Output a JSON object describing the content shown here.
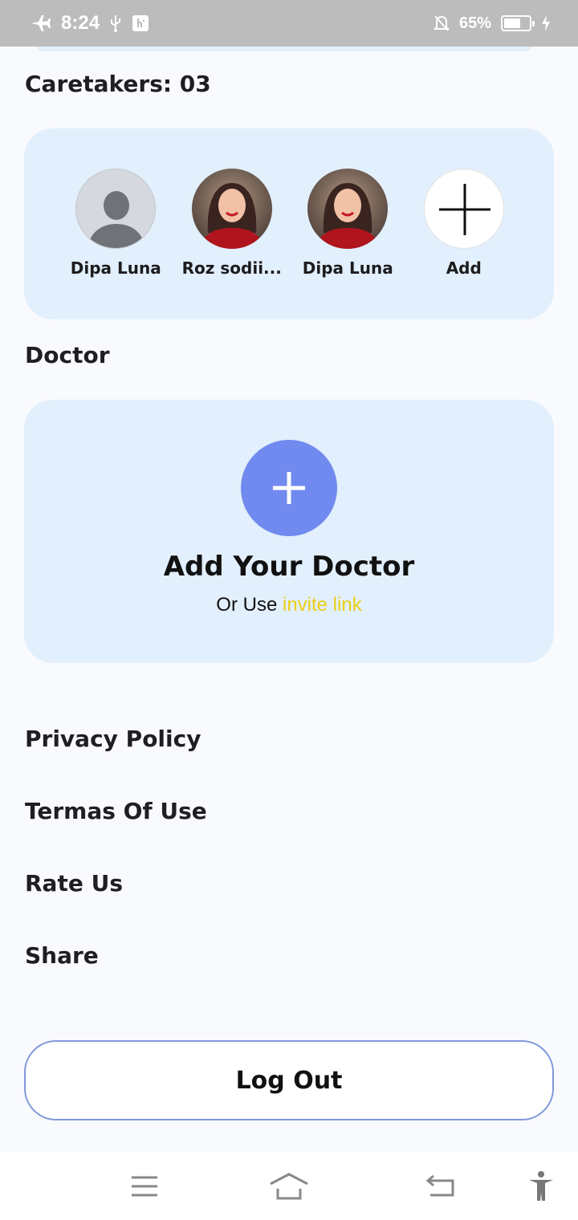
{
  "status_bar": {
    "time": "8:24",
    "battery_pct": "65%",
    "battery_level": 0.65,
    "icons": [
      "airplane-mode-icon",
      "usb-icon",
      "usb-debug-icon",
      "notifications-off-icon",
      "battery-icon",
      "charging-icon"
    ]
  },
  "caretakers": {
    "title": "Caretakers: 03",
    "items": [
      {
        "name": "Dipa Luna",
        "avatar": "generic-person"
      },
      {
        "name": "Roz sodii...",
        "avatar": "photo"
      },
      {
        "name": "Dipa Luna",
        "avatar": "photo"
      },
      {
        "name": "Add",
        "avatar": "plus-icon"
      }
    ]
  },
  "doctor": {
    "title": "Doctor",
    "card_title": "Add Your Doctor",
    "sub_prefix": "Or Use ",
    "sub_link": "invite link"
  },
  "menu": {
    "privacy": "Privacy Policy",
    "terms": "Termas Of Use",
    "rate": "Rate Us",
    "share": "Share"
  },
  "logout_label": "Log Out",
  "colors": {
    "card_bg": "#e2effc",
    "accent_blue": "#708aef",
    "link_yellow": "#e9cf1a",
    "logout_border": "#7f98da"
  },
  "nav_bar": {
    "icons": [
      "menu-icon",
      "home-icon",
      "back-icon",
      "accessibility-icon"
    ]
  }
}
